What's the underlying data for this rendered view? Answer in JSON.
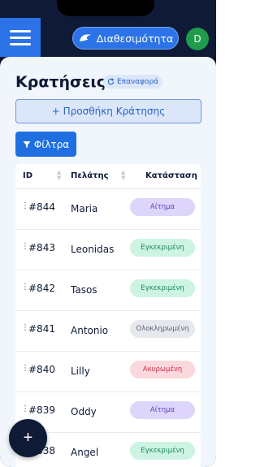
{
  "header": {
    "availability_label": "Διαθεσιμότητα",
    "avatar_initial": "D"
  },
  "page": {
    "title": "Κρατήσεις",
    "reset_label": "Επαναφορά",
    "add_button_label": "+ Προσθήκη Κράτησης",
    "filter_button_label": "Φίλτρα"
  },
  "table": {
    "columns": [
      "ID",
      "Πελάτης",
      "Κατάσταση"
    ],
    "rows": [
      {
        "id": "#844",
        "customer": "Maria",
        "status": "Αίτημα",
        "status_type": "request"
      },
      {
        "id": "#843",
        "customer": "Leonidas",
        "status": "Εγκεκριμένη",
        "status_type": "approved"
      },
      {
        "id": "#842",
        "customer": "Tasos",
        "status": "Εγκεκριμένη",
        "status_type": "approved"
      },
      {
        "id": "#841",
        "customer": "Antonio",
        "status": "Ολοκληρωμένη",
        "status_type": "completed"
      },
      {
        "id": "#840",
        "customer": "Lilly",
        "status": "Ακυρωμένη",
        "status_type": "cancelled"
      },
      {
        "id": "#839",
        "customer": "Oddy",
        "status": "Αίτημα",
        "status_type": "request"
      },
      {
        "id": "#838",
        "customer": "Angel",
        "status": "Εγκεκριμένη",
        "status_type": "approved"
      }
    ]
  },
  "fab": {
    "label": "+"
  },
  "icons": {
    "menu": "hamburger-icon",
    "availability": "wave-icon",
    "reset": "refresh-icon",
    "filter": "funnel-icon",
    "drag": "drag-handle-icon",
    "sort": "sort-icon"
  },
  "colors": {
    "primary": "#2b73e6",
    "dark": "#0f1a36",
    "avatar": "#1e9b4b",
    "request": "#ddd6fa",
    "approved": "#cdf3e3",
    "completed": "#e6e8ed",
    "cancelled": "#fbd8dd"
  }
}
